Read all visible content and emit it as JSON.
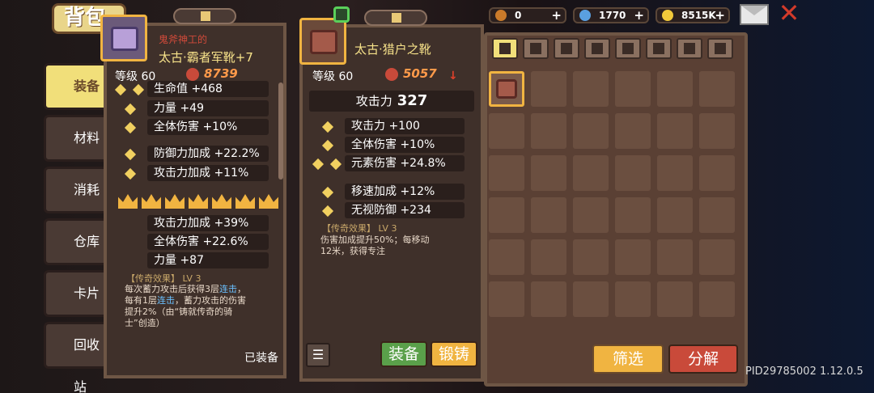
{
  "header": {
    "title": "背包"
  },
  "resources": [
    {
      "value": "0",
      "color": "#c97a2a",
      "icon": "key-icon"
    },
    {
      "value": "1770",
      "color": "#5aa0e0",
      "icon": "gem-icon"
    },
    {
      "value": "8515K",
      "color": "#f1c93a",
      "icon": "coin-icon"
    }
  ],
  "sidebar": {
    "items": [
      {
        "label": "装备",
        "active": true
      },
      {
        "label": "材料"
      },
      {
        "label": "消耗品"
      },
      {
        "label": "仓库"
      },
      {
        "label": "卡片"
      },
      {
        "label": "回收站"
      }
    ]
  },
  "card_left": {
    "subtitle": "鬼斧神工的",
    "name": "太古·霸者军靴+7",
    "level": "等级 60",
    "score": "8739",
    "stats_top": [
      {
        "label": "生命值 +468",
        "stars": 2
      },
      {
        "label": "力量 +49",
        "stars": 1
      },
      {
        "label": "全体伤害 +10%",
        "stars": 1
      },
      {
        "label": "防御力加成 +22.2%",
        "stars": 1
      },
      {
        "label": "攻击力加成 +11%",
        "stars": 1
      }
    ],
    "stats_bottom": [
      {
        "label": "攻击力加成 +39%"
      },
      {
        "label": "全体伤害 +22.6%"
      },
      {
        "label": "力量 +87"
      }
    ],
    "crowns": 7,
    "legend_title": "【传奇效果】 LV 3",
    "legend_l1a": "每次蓄力攻击后获得3层",
    "legend_l1b": "连击",
    "legend_l1c": "，",
    "legend_l2a": "每有1层",
    "legend_l2b": "连击",
    "legend_l2c": "，蓄力攻击的伤害",
    "legend_l3": "提升2%（由“铸就传奇的骑",
    "legend_l4": "士”创造）",
    "equipped": "已装备"
  },
  "card_right": {
    "name": "太古·猎户之靴",
    "level": "等级 60",
    "score": "5057",
    "attack_label": "攻击力",
    "attack_value": "327",
    "stats_top": [
      {
        "label": "攻击力 +100",
        "stars": 1
      },
      {
        "label": "全体伤害 +10%",
        "stars": 1
      },
      {
        "label": "元素伤害 +24.8%",
        "stars": 2
      }
    ],
    "stats_bottom": [
      {
        "label": "移速加成 +12%",
        "stars": 1
      },
      {
        "label": "无视防御 +234",
        "stars": 1
      }
    ],
    "legend_title": "【传奇效果】 LV 3",
    "legend_l1": "伤害加成提升50%；每移动",
    "legend_l2": "12米，获得专注",
    "equip_button": "装备",
    "forge_button": "锻铸"
  },
  "inventory": {
    "filter_button": "筛选",
    "decompose_button": "分解"
  },
  "footer": {
    "pid": "PID29785002 1.12.0.5"
  }
}
